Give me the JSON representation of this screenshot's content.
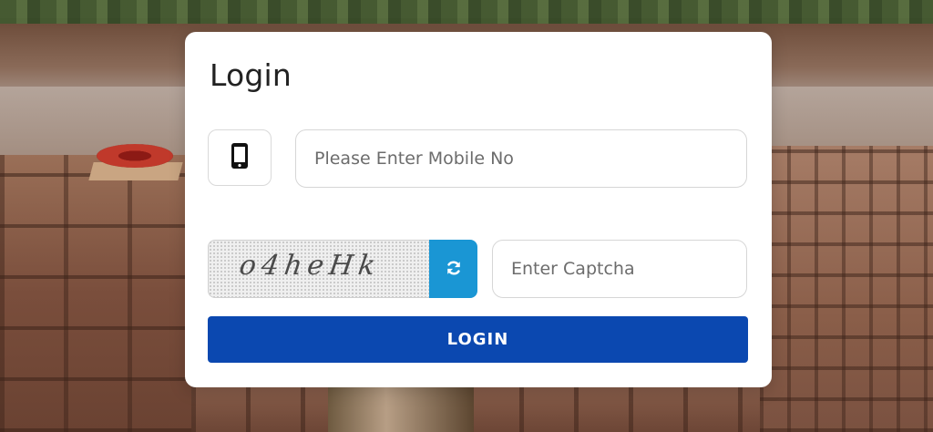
{
  "login": {
    "title": "Login",
    "mobile_placeholder": "Please Enter Mobile No",
    "mobile_value": "",
    "captcha_text": "o4heHk",
    "captcha_placeholder": "Enter Captcha",
    "captcha_value": "",
    "button_label": "LOGIN"
  },
  "icons": {
    "phone": "mobile-phone-icon",
    "refresh": "refresh-icon"
  },
  "colors": {
    "primary_button": "#0b48b0",
    "refresh_button": "#1a96d4",
    "card_background": "#ffffff"
  }
}
